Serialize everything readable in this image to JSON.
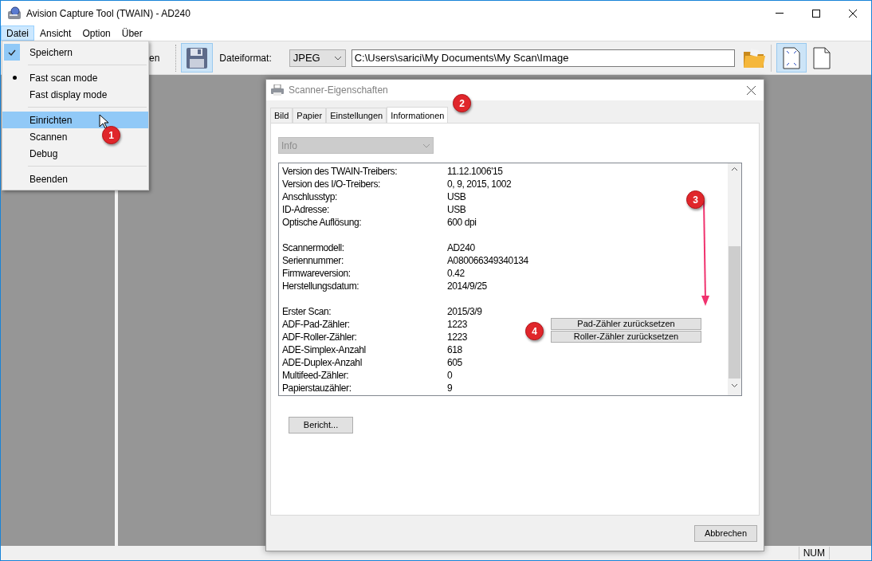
{
  "window": {
    "title": "Avision Capture Tool (TWAIN) - AD240"
  },
  "menu_bar": [
    {
      "label": "Datei",
      "selected": true
    },
    {
      "label": "Ansicht",
      "selected": false
    },
    {
      "label": "Option",
      "selected": false
    },
    {
      "label": "Über",
      "selected": false
    }
  ],
  "dropdown": [
    {
      "kind": "item",
      "label": "Speichern",
      "checked": true,
      "radio": false,
      "selected": false
    },
    {
      "kind": "separator"
    },
    {
      "kind": "item",
      "label": "Fast scan mode",
      "checked": false,
      "radio": true,
      "selected": false
    },
    {
      "kind": "item",
      "label": "Fast display mode",
      "checked": false,
      "radio": false,
      "selected": false
    },
    {
      "kind": "separator"
    },
    {
      "kind": "item",
      "label": "Einrichten",
      "checked": false,
      "radio": false,
      "selected": true
    },
    {
      "kind": "item",
      "label": "Scannen",
      "checked": false,
      "radio": false,
      "selected": false
    },
    {
      "kind": "item",
      "label": "Debug",
      "checked": false,
      "radio": false,
      "selected": false
    },
    {
      "kind": "separator"
    },
    {
      "kind": "item",
      "label": "Beenden",
      "checked": false,
      "radio": false,
      "selected": false
    }
  ],
  "toolbar": {
    "partial_button": "en",
    "format_label": "Dateiformat:",
    "format_value": "JPEG",
    "path_value": "C:\\Users\\sarici\\My Documents\\My Scan\\Image"
  },
  "dialog": {
    "title": "Scanner-Eigenschaften",
    "tabs": [
      {
        "label": "Bild",
        "selected": false
      },
      {
        "label": "Papier",
        "selected": false
      },
      {
        "label": "Einstellungen",
        "selected": false
      },
      {
        "label": "Informationen",
        "selected": true
      }
    ],
    "selector": {
      "value": "Info",
      "disabled": true
    },
    "info_rows": [
      {
        "kind": "row",
        "label": "Version des TWAIN-Treibers:",
        "value": "11.12.1006'15"
      },
      {
        "kind": "row",
        "label": "Version des I/O-Treibers:",
        "value": "0, 9, 2015, 1002"
      },
      {
        "kind": "row",
        "label": "Anschlusstyp:",
        "value": "USB"
      },
      {
        "kind": "row",
        "label": "ID-Adresse:",
        "value": "USB"
      },
      {
        "kind": "row",
        "label": "Optische Auflösung:",
        "value": "600 dpi"
      },
      {
        "kind": "gap"
      },
      {
        "kind": "row",
        "label": "Scannermodell:",
        "value": "AD240"
      },
      {
        "kind": "row",
        "label": "Seriennummer:",
        "value": "A080066349340134"
      },
      {
        "kind": "row",
        "label": "Firmwareversion:",
        "value": "0.42"
      },
      {
        "kind": "row",
        "label": "Herstellungsdatum:",
        "value": "2014/9/25"
      },
      {
        "kind": "gap"
      },
      {
        "kind": "row",
        "label": "Erster Scan:",
        "value": "2015/3/9"
      },
      {
        "kind": "row",
        "label": "ADF-Pad-Zähler:",
        "value": "1223"
      },
      {
        "kind": "row",
        "label": "ADF-Roller-Zähler:",
        "value": "1223"
      },
      {
        "kind": "row",
        "label": "ADE-Simplex-Anzahl",
        "value": "618"
      },
      {
        "kind": "row",
        "label": "ADE-Duplex-Anzahl",
        "value": "605"
      },
      {
        "kind": "row",
        "label": "Multifeed-Zähler:",
        "value": "0"
      },
      {
        "kind": "row",
        "label": "Papierstauzähler:",
        "value": "9"
      }
    ],
    "reset_buttons": [
      "Pad-Zähler zurücksetzen",
      "Roller-Zähler zurücksetzen"
    ],
    "report_button": "Bericht...",
    "cancel_button": "Abbrechen"
  },
  "annotations": [
    "1",
    "2",
    "3",
    "4"
  ],
  "status_bar": {
    "indicator": "NUM"
  }
}
